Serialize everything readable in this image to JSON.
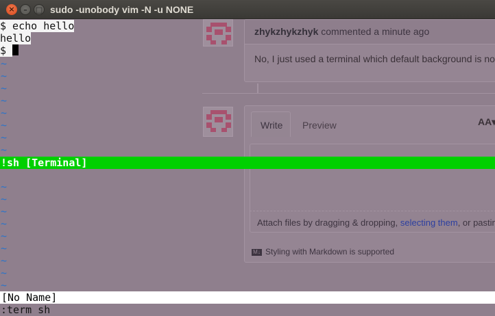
{
  "window": {
    "title": "sudo -unobody vim -N -u NONE",
    "close_glyph": "×",
    "minimize_glyph": "–",
    "maximize_glyph": "□"
  },
  "terminal": {
    "line1": "$ echo hello",
    "line2": "hello",
    "prompt": "$ ",
    "tilde": "~",
    "status_line": "!sh [Terminal]",
    "buffer_status": "[No Name]",
    "command_line": ":term sh"
  },
  "background_page": {
    "comment": {
      "author": "zhykzhykzhyk",
      "meta": "commented a minute ago",
      "body": "No, I just used a terminal which default background is no"
    },
    "editor_tabs": [
      "Write",
      "Preview"
    ],
    "font_toggle": "AA▾",
    "attach_prefix": "Attach files by dragging & dropping, ",
    "attach_link": "selecting them",
    "attach_suffix": ", or pastin",
    "markdown_note": "Styling with Markdown is supported",
    "markdown_icon": "M↓"
  },
  "colors": {
    "status_green": "#00d000",
    "tilde_blue": "#2b74c9",
    "close_orange": "#e05a2b"
  }
}
